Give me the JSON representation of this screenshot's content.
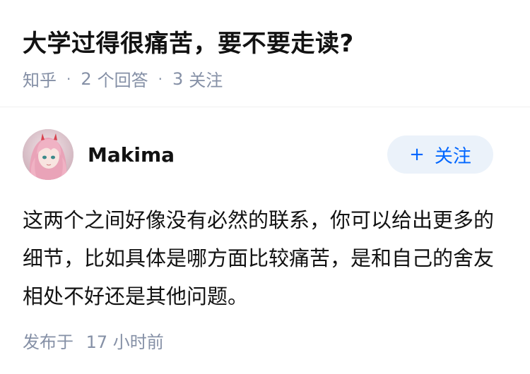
{
  "question": {
    "title": "大学过得很痛苦，要不要走读?",
    "source": "知乎",
    "answer_count": "2",
    "answer_label": "个回答",
    "follow_count": "3",
    "follow_label": "关注"
  },
  "answer": {
    "author_name": "Makima",
    "follow_button_label": "关注",
    "follow_button_icon": "plus-icon",
    "avatar_icon": "anime-girl-pink-hair-avatar",
    "content": "这两个之间好像没有必然的联系，你可以给出更多的细节，比如具体是哪方面比较痛苦，是和自己的舍友相处不好还是其他问题。",
    "published_label": "发布于",
    "published_time": "17 小时前"
  },
  "colors": {
    "accent": "#0066ff",
    "button_bg": "#ebf2fa",
    "meta_text": "#8590a6",
    "primary_text": "#121212"
  }
}
